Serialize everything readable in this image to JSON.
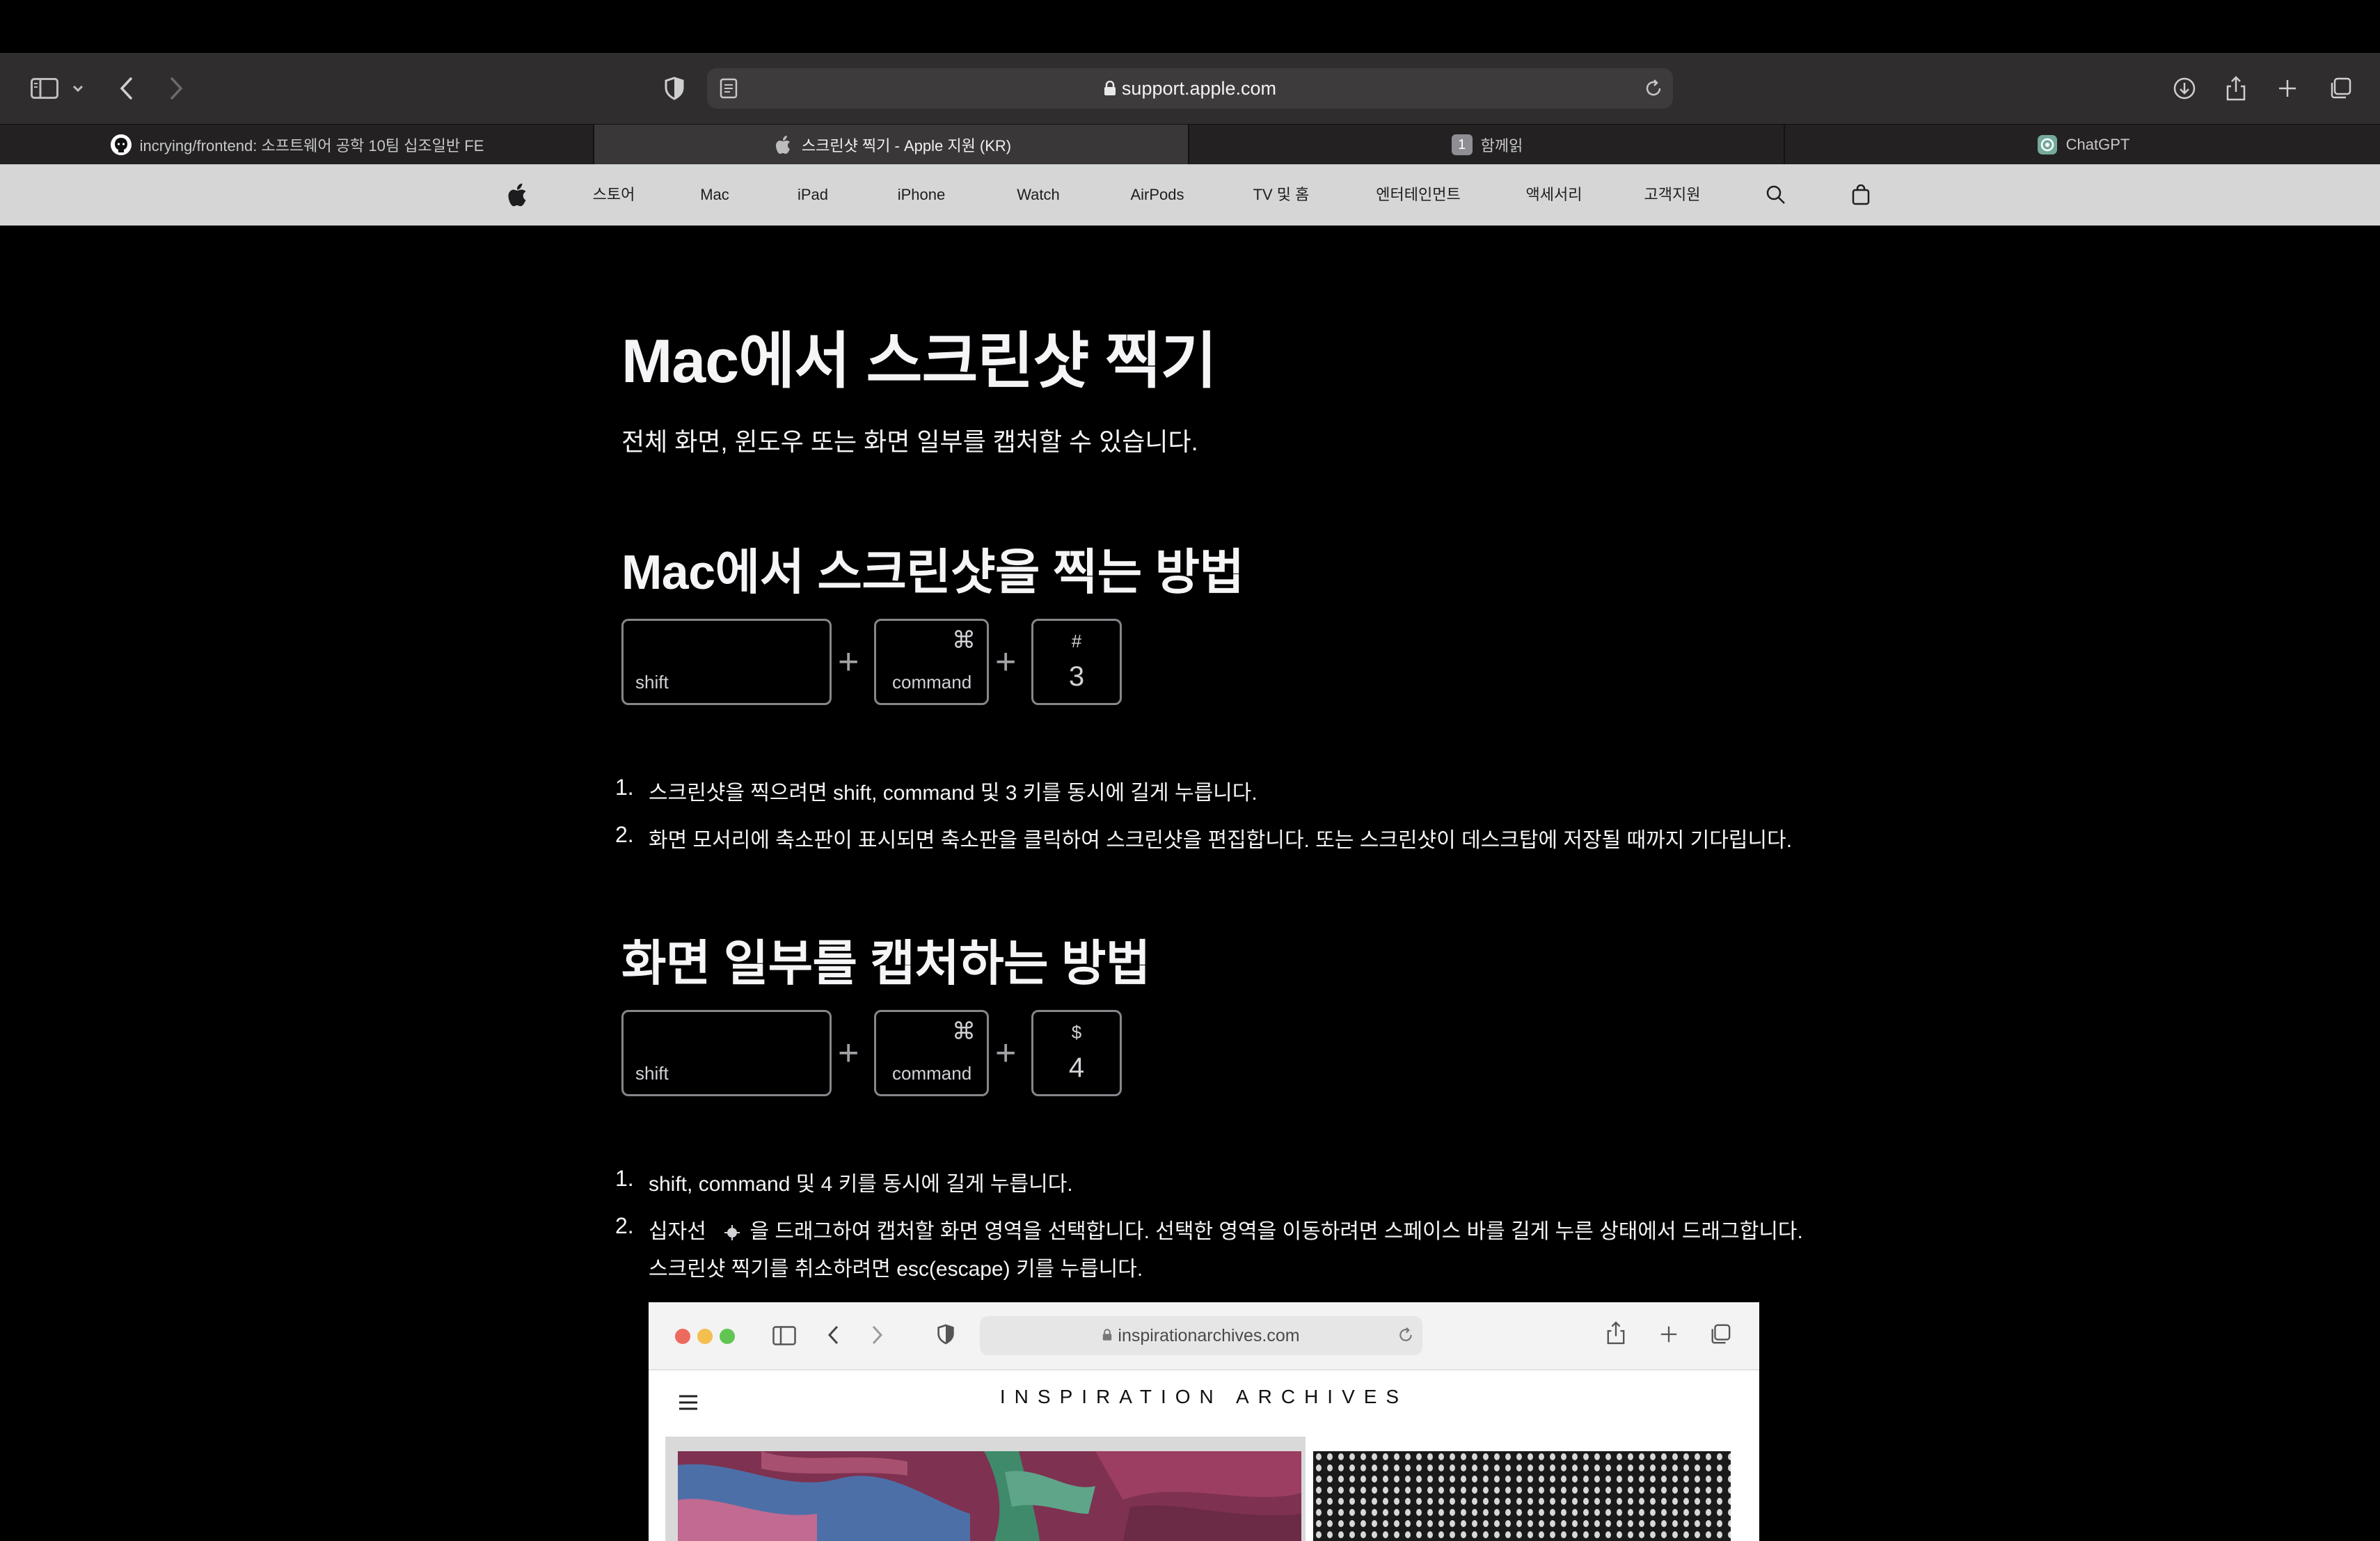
{
  "browser": {
    "url": "support.apple.com",
    "tabs": [
      {
        "title": "incrying/frontend: 소프트웨어 공학 10팀 십조일반 FE",
        "favicon": "github-icon"
      },
      {
        "title": "스크린샷 찍기 - Apple 지원 (KR)",
        "favicon": "apple-logo-icon",
        "active": true
      },
      {
        "title": "함께읽",
        "favicon": "numbered-tab-icon",
        "badge": "1"
      },
      {
        "title": "ChatGPT",
        "favicon": "chatgpt-icon"
      }
    ]
  },
  "globalnav": {
    "items": [
      "스토어",
      "Mac",
      "iPad",
      "iPhone",
      "Watch",
      "AirPods",
      "TV 및 홈",
      "엔터테인먼트",
      "액세서리",
      "고객지원"
    ]
  },
  "article": {
    "title": "Mac에서 스크린샷 찍기",
    "intro": "전체 화면, 윈도우 또는 화면 일부를 캡처할 수 있습니다.",
    "section1": {
      "heading": "Mac에서 스크린샷을 찍는 방법",
      "keys": {
        "shift": "shift",
        "command_symbol": "⌘",
        "command": "command",
        "key_symbol": "#",
        "key": "3"
      },
      "steps": [
        "스크린샷을 찍으려면 shift, command 및 3 키를 동시에 길게 누릅니다.",
        "화면 모서리에 축소판이 표시되면 축소판을 클릭하여 스크린샷을 편집합니다. 또는 스크린샷이 데스크탑에 저장될 때까지 기다립니다."
      ]
    },
    "section2": {
      "heading": "화면 일부를 캡처하는 방법",
      "keys": {
        "shift": "shift",
        "command_symbol": "⌘",
        "command": "command",
        "key_symbol": "$",
        "key": "4"
      },
      "steps": [
        "shift, command 및 4 키를 동시에 길게 누릅니다.",
        "십자선",
        "을 드래그하여 캡처할 화면 영역을 선택합니다. 선택한 영역을 이동하려면 스페이스 바를 길게 누른 상태에서 드래그합니다.",
        "스크린샷 찍기를 취소하려면 esc(escape) 키를 누릅니다."
      ],
      "step_numbers": [
        "1.",
        "2."
      ]
    },
    "embedded_screenshot": {
      "url": "inspirationarchives.com",
      "brand": "INSPIRATION ARCHIVES"
    }
  },
  "colors": {
    "toolbar": "#302d2e",
    "tabbar": "#232122",
    "globalnav": "#d6d6d6",
    "page_bg": "#000000"
  }
}
